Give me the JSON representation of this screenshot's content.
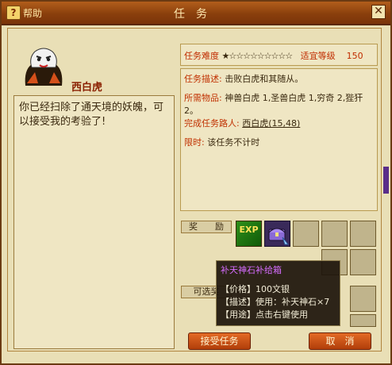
{
  "titlebar": {
    "help_label": "帮助",
    "help_icon": "help-icon",
    "title": "任务",
    "close_icon": "close-icon"
  },
  "npc": {
    "name": "西白虎"
  },
  "dialog": {
    "text": "你已经扫除了通天境的妖魄，可以接受我的考验了!"
  },
  "quest": {
    "difficulty_label": "任务难度",
    "difficulty_stars": "★☆☆☆☆☆☆☆☆☆",
    "level_label": "适宜等级",
    "level_value": "150",
    "desc_label": "任务描述:",
    "desc_value": "击败白虎和其随从。",
    "items_label": "所需物品:",
    "items_value": "神兽白虎 1,圣兽白虎 1,穷奇 2,狴犴 2。",
    "npc_label": "完成任务路人:",
    "npc_link": "西白虎(15,48)",
    "time_label": "限时:",
    "time_value": "该任务不计时"
  },
  "rewards": {
    "reward_label": "奖　　励",
    "optional_label": "可选奖",
    "exp_icon_text": "EXP"
  },
  "tooltip": {
    "title": "补天神石补给箱",
    "price_label": "【价格】",
    "price_value": "100文银",
    "desc_label": "【描述】",
    "desc_value": "使用：补天神石×7",
    "use_label": "【用途】",
    "use_value": "点击右键使用"
  },
  "buttons": {
    "accept": "接受任务",
    "cancel": "取　消"
  },
  "colors": {
    "title_bar": "#8a3f0c",
    "panel": "#e9dfb6",
    "label_red": "#c03000",
    "tooltip_title": "#d66cff"
  }
}
